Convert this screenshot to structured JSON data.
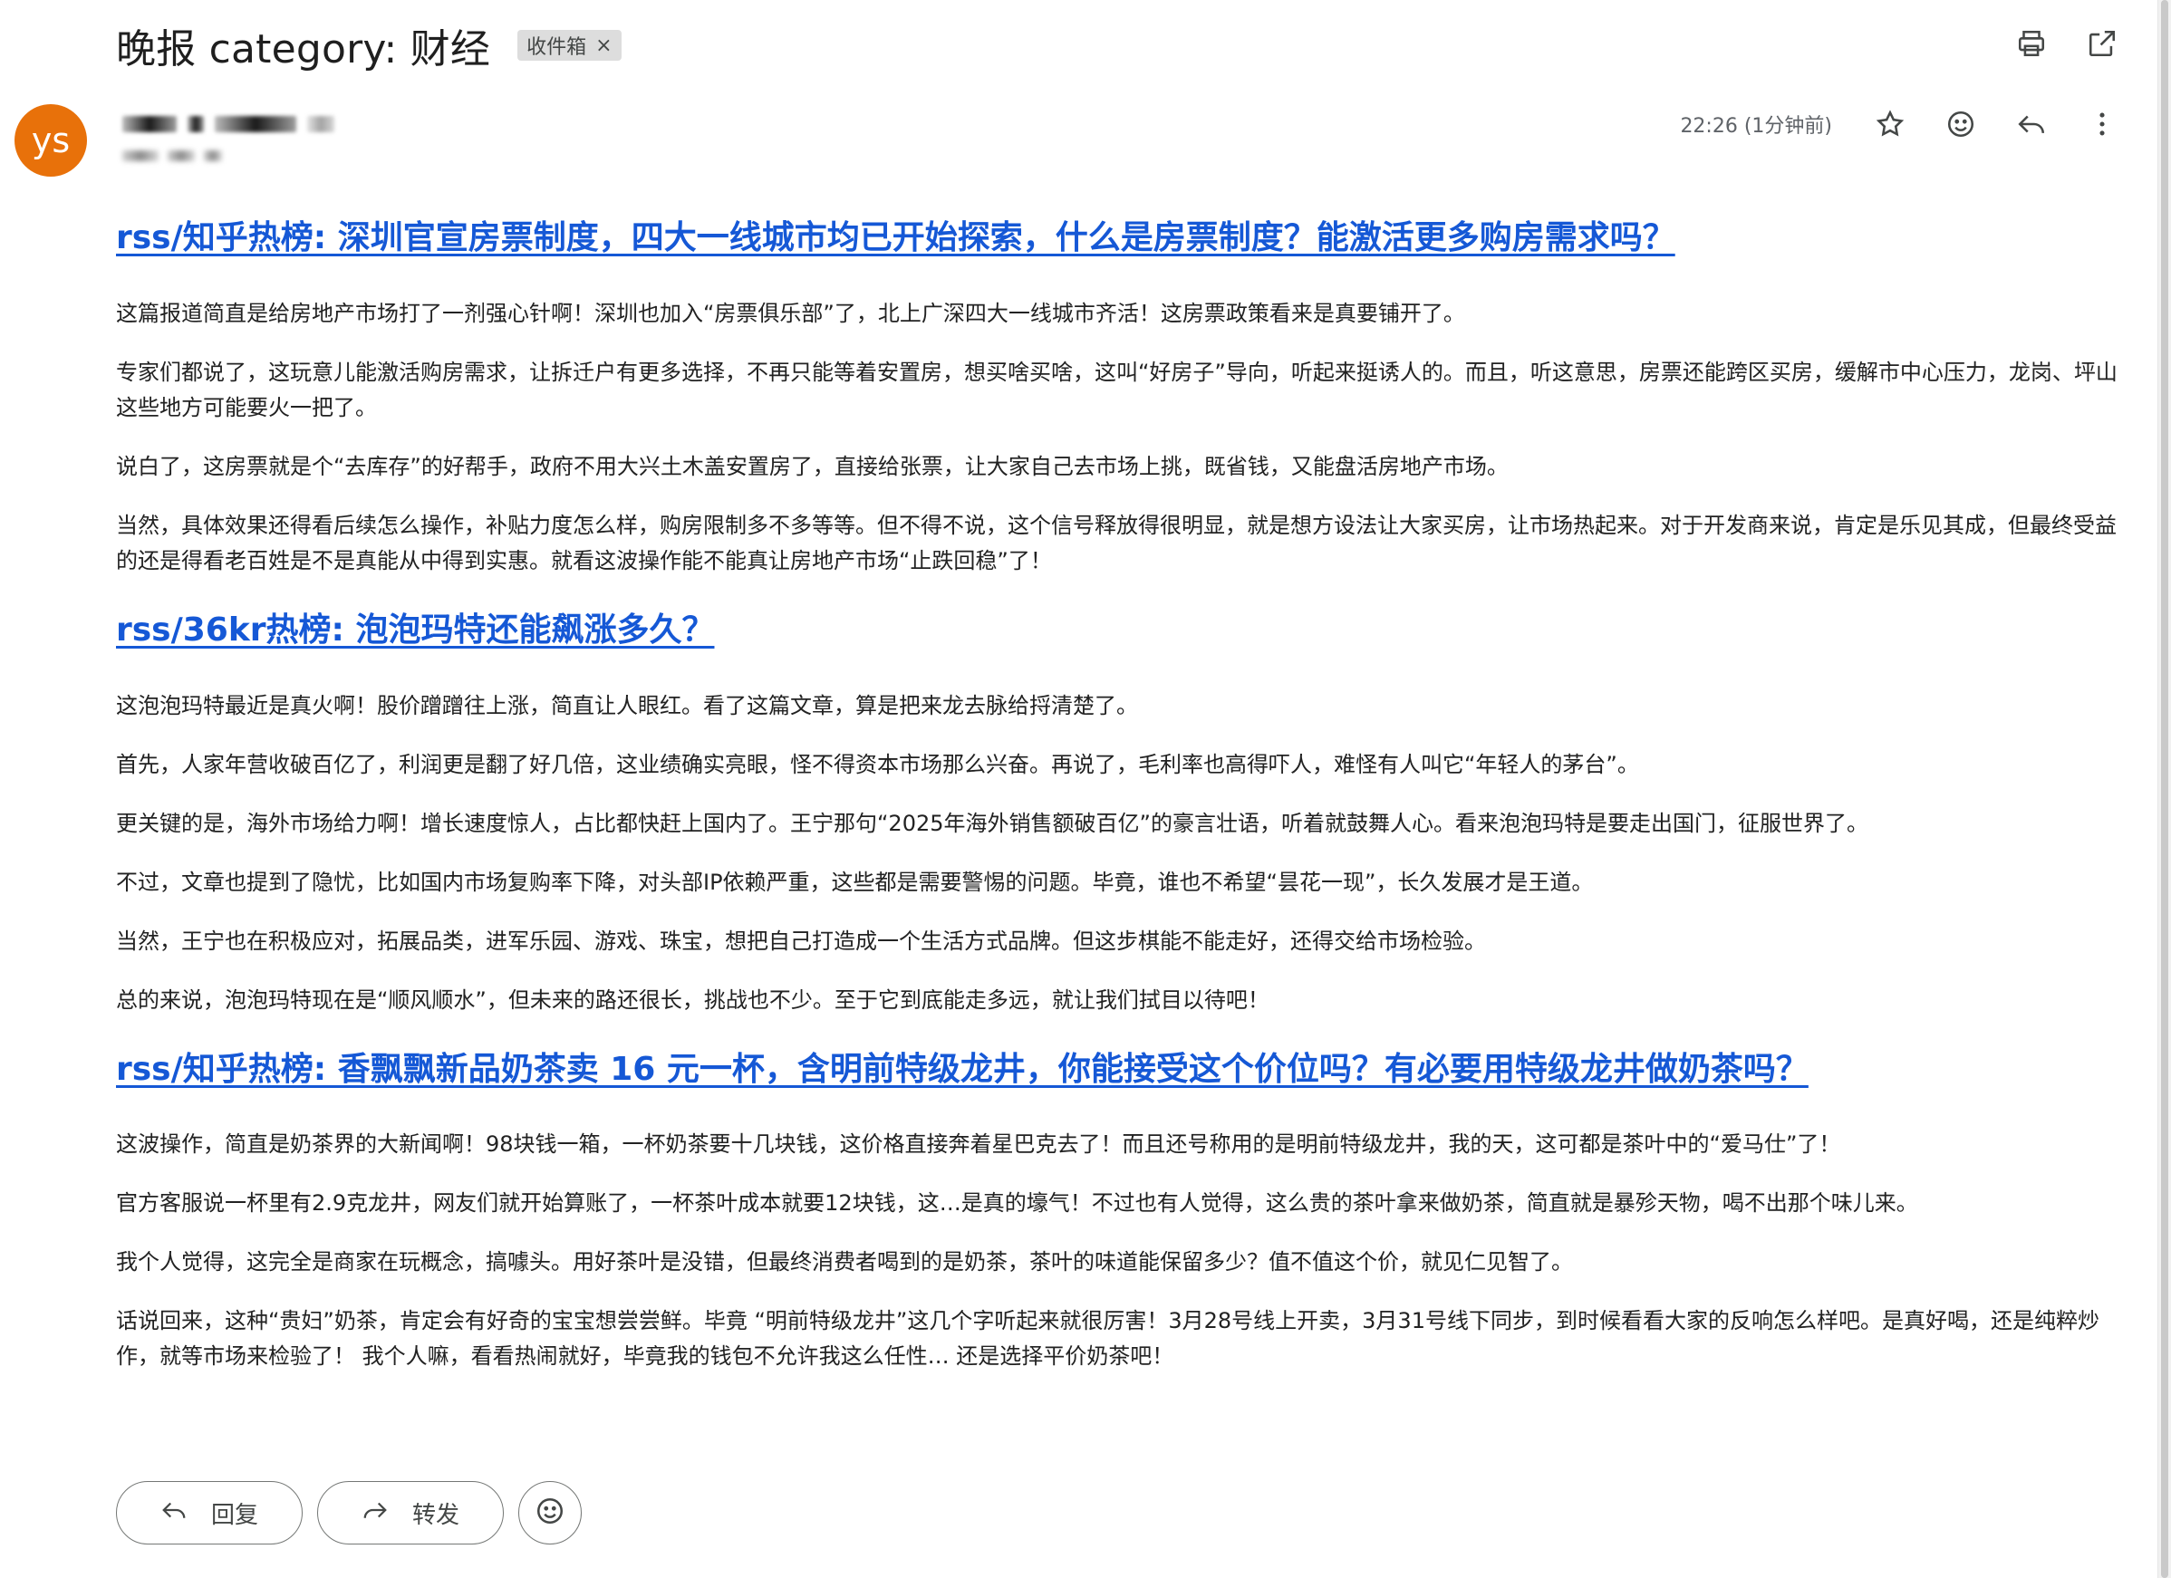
{
  "email": {
    "subject": "晚报 category: 财经",
    "label_chip": "收件箱",
    "label_close": "×",
    "avatar_initials": "ys",
    "time": "22:26 (1分钟前)"
  },
  "icons": {
    "print": "printer-icon",
    "open_new": "open-in-new-window-icon",
    "star": "star-icon",
    "emoji": "emoji-icon",
    "reply": "reply-icon",
    "more": "more-vertical-icon",
    "forward": "forward-icon"
  },
  "articles": [
    {
      "title": "rss/知乎热榜: 深圳官宣房票制度，四大一线城市均已开始探索，什么是房票制度？能激活更多购房需求吗？",
      "paragraphs": [
        "这篇报道简直是给房地产市场打了一剂强心针啊！深圳也加入“房票俱乐部”了，北上广深四大一线城市齐活！这房票政策看来是真要铺开了。",
        "专家们都说了，这玩意儿能激活购房需求，让拆迁户有更多选择，不再只能等着安置房，想买啥买啥，这叫“好房子”导向，听起来挺诱人的。而且，听这意思，房票还能跨区买房，缓解市中心压力，龙岗、坪山这些地方可能要火一把了。",
        "说白了，这房票就是个“去库存”的好帮手，政府不用大兴土木盖安置房了，直接给张票，让大家自己去市场上挑，既省钱，又能盘活房地产市场。",
        "当然，具体效果还得看后续怎么操作，补贴力度怎么样，购房限制多不多等等。但不得不说，这个信号释放得很明显，就是想方设法让大家买房，让市场热起来。对于开发商来说，肯定是乐见其成，但最终受益的还是得看老百姓是不是真能从中得到实惠。就看这波操作能不能真让房地产市场“止跌回稳”了！"
      ]
    },
    {
      "title": "rss/36kr热榜: 泡泡玛特还能飙涨多久？",
      "paragraphs": [
        "这泡泡玛特最近是真火啊！股价蹭蹭往上涨，简直让人眼红。看了这篇文章，算是把来龙去脉给捋清楚了。",
        "首先，人家年营收破百亿了，利润更是翻了好几倍，这业绩确实亮眼，怪不得资本市场那么兴奋。再说了，毛利率也高得吓人，难怪有人叫它“年轻人的茅台”。",
        "更关键的是，海外市场给力啊！增长速度惊人，占比都快赶上国内了。王宁那句“2025年海外销售额破百亿”的豪言壮语，听着就鼓舞人心。看来泡泡玛特是要走出国门，征服世界了。",
        "不过，文章也提到了隐忧，比如国内市场复购率下降，对头部IP依赖严重，这些都是需要警惕的问题。毕竟，谁也不希望“昙花一现”，长久发展才是王道。",
        "当然，王宁也在积极应对，拓展品类，进军乐园、游戏、珠宝，想把自己打造成一个生活方式品牌。但这步棋能不能走好，还得交给市场检验。",
        "总的来说，泡泡玛特现在是“顺风顺水”，但未来的路还很长，挑战也不少。至于它到底能走多远，就让我们拭目以待吧！"
      ]
    },
    {
      "title": "rss/知乎热榜: 香飘飘新品奶茶卖 16 元一杯，含明前特级龙井，你能接受这个价位吗？有必要用特级龙井做奶茶吗？",
      "paragraphs": [
        "这波操作，简直是奶茶界的大新闻啊！98块钱一箱，一杯奶茶要十几块钱，这价格直接奔着星巴克去了！而且还号称用的是明前特级龙井，我的天，这可都是茶叶中的“爱马仕”了！",
        "官方客服说一杯里有2.9克龙井，网友们就开始算账了，一杯茶叶成本就要12块钱，这…是真的壕气！不过也有人觉得，这么贵的茶叶拿来做奶茶，简直就是暴殄天物，喝不出那个味儿来。",
        "我个人觉得，这完全是商家在玩概念，搞噱头。用好茶叶是没错，但最终消费者喝到的是奶茶，茶叶的味道能保留多少？值不值这个价，就见仁见智了。",
        "话说回来，这种“贵妇”奶茶，肯定会有好奇的宝宝想尝尝鲜。毕竟 “明前特级龙井”这几个字听起来就很厉害！3月28号线上开卖，3月31号线下同步，到时候看看大家的反响怎么样吧。是真好喝，还是纯粹炒作，就等市场来检验了！ 我个人嘛，看看热闹就好，毕竟我的钱包不允许我这么任性… 还是选择平价奶茶吧！"
      ]
    }
  ],
  "footer": {
    "reply_label": "回复",
    "forward_label": "转发"
  },
  "colors": {
    "link": "#1558d6",
    "avatar": "#e8710a",
    "chip_bg": "#dddddd"
  }
}
